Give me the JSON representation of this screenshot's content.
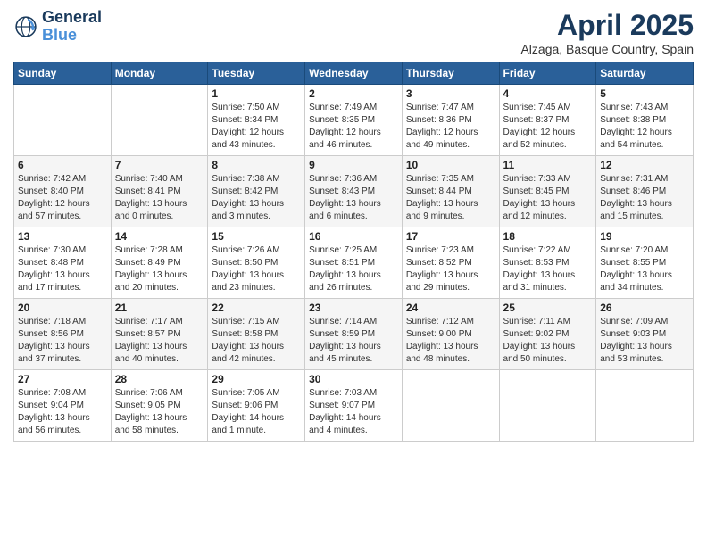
{
  "header": {
    "logo_line1": "General",
    "logo_line2": "Blue",
    "month_title": "April 2025",
    "location": "Alzaga, Basque Country, Spain"
  },
  "weekdays": [
    "Sunday",
    "Monday",
    "Tuesday",
    "Wednesday",
    "Thursday",
    "Friday",
    "Saturday"
  ],
  "weeks": [
    [
      {
        "day": "",
        "info": ""
      },
      {
        "day": "",
        "info": ""
      },
      {
        "day": "1",
        "info": "Sunrise: 7:50 AM\nSunset: 8:34 PM\nDaylight: 12 hours and 43 minutes."
      },
      {
        "day": "2",
        "info": "Sunrise: 7:49 AM\nSunset: 8:35 PM\nDaylight: 12 hours and 46 minutes."
      },
      {
        "day": "3",
        "info": "Sunrise: 7:47 AM\nSunset: 8:36 PM\nDaylight: 12 hours and 49 minutes."
      },
      {
        "day": "4",
        "info": "Sunrise: 7:45 AM\nSunset: 8:37 PM\nDaylight: 12 hours and 52 minutes."
      },
      {
        "day": "5",
        "info": "Sunrise: 7:43 AM\nSunset: 8:38 PM\nDaylight: 12 hours and 54 minutes."
      }
    ],
    [
      {
        "day": "6",
        "info": "Sunrise: 7:42 AM\nSunset: 8:40 PM\nDaylight: 12 hours and 57 minutes."
      },
      {
        "day": "7",
        "info": "Sunrise: 7:40 AM\nSunset: 8:41 PM\nDaylight: 13 hours and 0 minutes."
      },
      {
        "day": "8",
        "info": "Sunrise: 7:38 AM\nSunset: 8:42 PM\nDaylight: 13 hours and 3 minutes."
      },
      {
        "day": "9",
        "info": "Sunrise: 7:36 AM\nSunset: 8:43 PM\nDaylight: 13 hours and 6 minutes."
      },
      {
        "day": "10",
        "info": "Sunrise: 7:35 AM\nSunset: 8:44 PM\nDaylight: 13 hours and 9 minutes."
      },
      {
        "day": "11",
        "info": "Sunrise: 7:33 AM\nSunset: 8:45 PM\nDaylight: 13 hours and 12 minutes."
      },
      {
        "day": "12",
        "info": "Sunrise: 7:31 AM\nSunset: 8:46 PM\nDaylight: 13 hours and 15 minutes."
      }
    ],
    [
      {
        "day": "13",
        "info": "Sunrise: 7:30 AM\nSunset: 8:48 PM\nDaylight: 13 hours and 17 minutes."
      },
      {
        "day": "14",
        "info": "Sunrise: 7:28 AM\nSunset: 8:49 PM\nDaylight: 13 hours and 20 minutes."
      },
      {
        "day": "15",
        "info": "Sunrise: 7:26 AM\nSunset: 8:50 PM\nDaylight: 13 hours and 23 minutes."
      },
      {
        "day": "16",
        "info": "Sunrise: 7:25 AM\nSunset: 8:51 PM\nDaylight: 13 hours and 26 minutes."
      },
      {
        "day": "17",
        "info": "Sunrise: 7:23 AM\nSunset: 8:52 PM\nDaylight: 13 hours and 29 minutes."
      },
      {
        "day": "18",
        "info": "Sunrise: 7:22 AM\nSunset: 8:53 PM\nDaylight: 13 hours and 31 minutes."
      },
      {
        "day": "19",
        "info": "Sunrise: 7:20 AM\nSunset: 8:55 PM\nDaylight: 13 hours and 34 minutes."
      }
    ],
    [
      {
        "day": "20",
        "info": "Sunrise: 7:18 AM\nSunset: 8:56 PM\nDaylight: 13 hours and 37 minutes."
      },
      {
        "day": "21",
        "info": "Sunrise: 7:17 AM\nSunset: 8:57 PM\nDaylight: 13 hours and 40 minutes."
      },
      {
        "day": "22",
        "info": "Sunrise: 7:15 AM\nSunset: 8:58 PM\nDaylight: 13 hours and 42 minutes."
      },
      {
        "day": "23",
        "info": "Sunrise: 7:14 AM\nSunset: 8:59 PM\nDaylight: 13 hours and 45 minutes."
      },
      {
        "day": "24",
        "info": "Sunrise: 7:12 AM\nSunset: 9:00 PM\nDaylight: 13 hours and 48 minutes."
      },
      {
        "day": "25",
        "info": "Sunrise: 7:11 AM\nSunset: 9:02 PM\nDaylight: 13 hours and 50 minutes."
      },
      {
        "day": "26",
        "info": "Sunrise: 7:09 AM\nSunset: 9:03 PM\nDaylight: 13 hours and 53 minutes."
      }
    ],
    [
      {
        "day": "27",
        "info": "Sunrise: 7:08 AM\nSunset: 9:04 PM\nDaylight: 13 hours and 56 minutes."
      },
      {
        "day": "28",
        "info": "Sunrise: 7:06 AM\nSunset: 9:05 PM\nDaylight: 13 hours and 58 minutes."
      },
      {
        "day": "29",
        "info": "Sunrise: 7:05 AM\nSunset: 9:06 PM\nDaylight: 14 hours and 1 minute."
      },
      {
        "day": "30",
        "info": "Sunrise: 7:03 AM\nSunset: 9:07 PM\nDaylight: 14 hours and 4 minutes."
      },
      {
        "day": "",
        "info": ""
      },
      {
        "day": "",
        "info": ""
      },
      {
        "day": "",
        "info": ""
      }
    ]
  ]
}
